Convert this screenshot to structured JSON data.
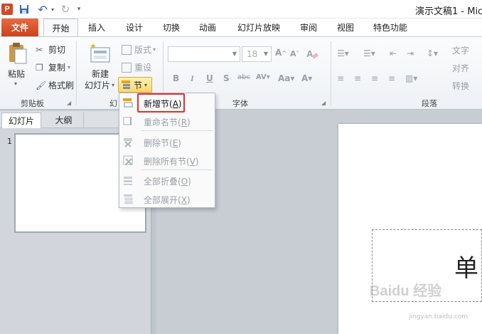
{
  "title_bar": {
    "app_icon": "powerpoint-icon",
    "app_letter": "P",
    "title": "演示文稿1 - Mic"
  },
  "tabs": [
    "文件",
    "开始",
    "插入",
    "设计",
    "切换",
    "动画",
    "幻灯片放映",
    "审阅",
    "视图",
    "特色功能"
  ],
  "active_tab": "开始",
  "ribbon": {
    "clipboard": {
      "group_label": "剪贴板",
      "paste": "粘贴",
      "cut": "剪切",
      "copy": "复制",
      "format_painter": "格式刷"
    },
    "slides": {
      "group_label": "幻",
      "new_slide_line1": "新建",
      "new_slide_line2": "幻灯片",
      "layout": "版式",
      "reset": "重设",
      "section": "节"
    },
    "font": {
      "group_label": "字体",
      "size": "18"
    },
    "paragraph": {
      "group_label": "段落",
      "text_direction": "文字",
      "align_text": "对齐",
      "convert": "转换"
    }
  },
  "section_menu": {
    "items": [
      {
        "label": "新增节",
        "key": "A",
        "enabled": true
      },
      {
        "label": "重命名节",
        "key": "R",
        "enabled": false
      },
      {
        "label": "删除节",
        "key": "E",
        "enabled": false
      },
      {
        "label": "删除所有节",
        "key": "V",
        "enabled": false
      },
      {
        "label": "全部折叠",
        "key": "O",
        "enabled": false
      },
      {
        "label": "全部展开",
        "key": "X",
        "enabled": false
      }
    ]
  },
  "left_pane": {
    "tabs": [
      "幻灯片",
      "大纲"
    ],
    "slide_number": "1"
  },
  "slide": {
    "title_text": "单"
  },
  "watermark": {
    "text": "Baidu 经验",
    "url": "jingyan.baidu.com"
  },
  "colors": {
    "file_tab": "#d24726",
    "highlight": "#e0302a",
    "section_button": "#ffd86b"
  }
}
